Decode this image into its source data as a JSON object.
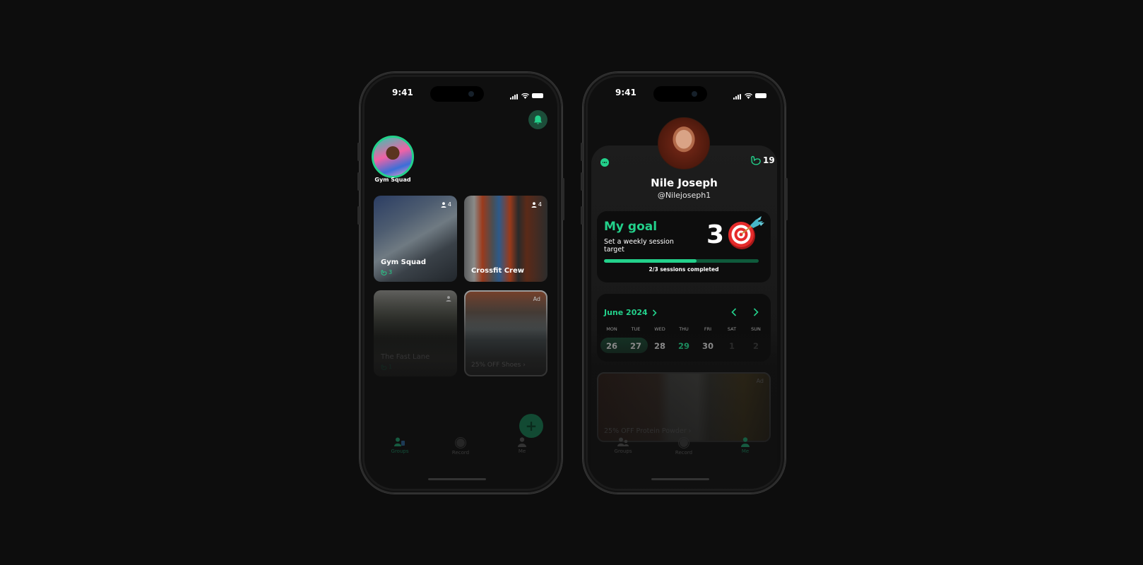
{
  "status_bar": {
    "time": "9:41"
  },
  "groups_screen": {
    "story": {
      "label": "Gym Squad"
    },
    "cards": [
      {
        "name": "Gym Squad",
        "members": "4",
        "streak": "3"
      },
      {
        "name": "Crossfit Crew",
        "members": "4"
      },
      {
        "name": "The Fast Lane",
        "streak": "1"
      }
    ],
    "ad": {
      "badge": "Ad",
      "label": "25% OFF Shoes",
      "chevron": "›"
    },
    "fab_label": "+",
    "tabs": [
      {
        "label": "Groups",
        "active": true
      },
      {
        "label": "Record",
        "active": false
      },
      {
        "label": "Me",
        "active": false
      }
    ]
  },
  "profile_screen": {
    "name": "Nile Joseph",
    "handle": "@Nilejoseph1",
    "streak_count": "19",
    "goal": {
      "title": "My goal",
      "subtitle": "Set a weekly session target",
      "target": "3",
      "progress_fraction": 0.6,
      "progress_text": "2/3 sessions completed"
    },
    "calendar": {
      "month": "June 2024",
      "days": [
        {
          "name": "MON",
          "num": "26",
          "state": "selected"
        },
        {
          "name": "TUE",
          "num": "27",
          "state": "selected"
        },
        {
          "name": "WED",
          "num": "28",
          "state": "normal"
        },
        {
          "name": "THU",
          "num": "29",
          "state": "today"
        },
        {
          "name": "FRI",
          "num": "30",
          "state": "normal"
        },
        {
          "name": "SAT",
          "num": "1",
          "state": "future"
        },
        {
          "name": "SUN",
          "num": "2",
          "state": "future"
        }
      ]
    },
    "ad": {
      "badge": "Ad",
      "label": "25% OFF Protein Powder",
      "chevron": "›"
    },
    "tabs": [
      {
        "label": "Groups",
        "active": false
      },
      {
        "label": "Record",
        "active": false
      },
      {
        "label": "Me",
        "active": true
      }
    ]
  },
  "colors": {
    "accent": "#23d18b",
    "background": "#0d0d0d",
    "card": "#0d0d0d"
  }
}
